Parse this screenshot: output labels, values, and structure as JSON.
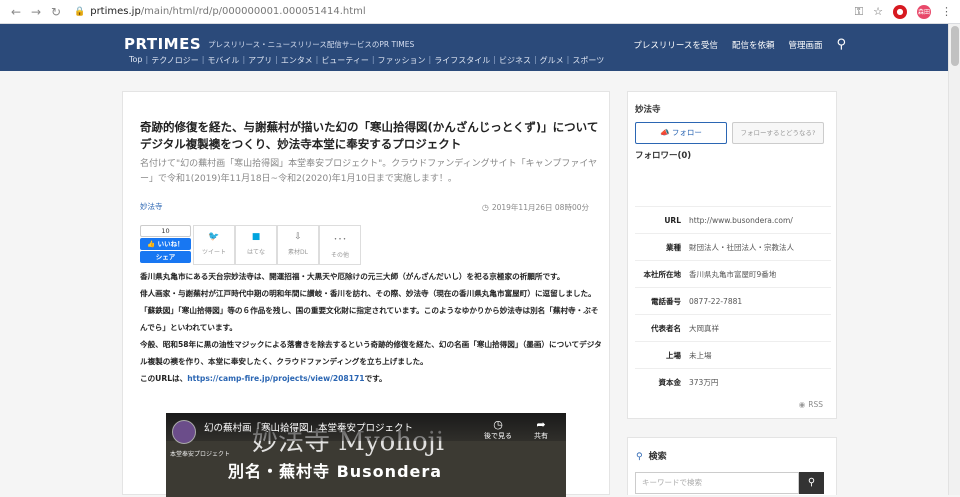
{
  "browser": {
    "url_host": "prtimes.jp",
    "url_path": "/main/html/rd/p/000000001.000051414.html",
    "avatar_text": "森田"
  },
  "header": {
    "logo": "PRTIMES",
    "tagline": "プレスリリース・ニュースリリース配信サービスのPR TIMES",
    "categories": [
      "Top",
      "テクノロジー",
      "モバイル",
      "アプリ",
      "エンタメ",
      "ビューティー",
      "ファッション",
      "ライフスタイル",
      "ビジネス",
      "グルメ",
      "スポーツ"
    ],
    "links": [
      "プレスリリースを受信",
      "配信を依頼",
      "管理画面"
    ]
  },
  "article": {
    "title": "奇跡的修復を経た、与謝蕪村が描いた幻の「寒山拾得図(かんざんじっとくず)」についてデジタル複製襖をつくり、妙法寺本堂に奉安するプロジェクト",
    "subtitle": "名付けて\"幻の蕪村画「寒山拾得図」本堂奉安プロジェクト\"。クラウドファンディングサイト「キャンプファイヤー」で令和1(2019)年11月18日~令和2(2020)年1月10日まで実施します！。",
    "company": "妙法寺",
    "date": "2019年11月26日 08時00分",
    "share": {
      "fb_count": "10",
      "fb_like": "いいね！",
      "fb_share": "シェア",
      "tweet": "ツイート",
      "hatena": "はてな",
      "pdf": "素材DL",
      "other": "その他"
    },
    "paragraphs": [
      "香川県丸亀市にある天台宗妙法寺は、開運招福・大黒天や厄除けの元三大師（がんざんだいし）を祀る京極家の祈願所です。",
      "俳人画家・与謝蕪村が江戸時代中期の明和年間に讃岐・香川を訪れ、その際、妙法寺（現在の香川県丸亀市富屋町）に逗留しました。「蘇鉄図」「寒山拾得図」等の６作品を残し、国の重要文化財に指定されています。このようなゆかりから妙法寺は別名「蕪村寺・ぶそんでら」といわれています。",
      "今般、昭和58年に黒の油性マジックによる落書きを除去するという奇跡的修復を経た、幻の名画「寒山拾得図」（墨画）についてデジタル複製の襖を作り、本堂に奉安したく、クラウドファンディングを立ち上げました。"
    ],
    "url_prefix": "このURLは、",
    "url_link": "https://camp-fire.jp/projects/view/208171",
    "url_suffix": "です。"
  },
  "video": {
    "title": "幻の蕪村画「寒山拾得図」本堂奉安プロジェクト",
    "watch_later": "後で見る",
    "share": "共有",
    "big_text": "妙法寺 Myohoji",
    "sub_text": "別名・蕪村寺 Busondera",
    "caption": "本堂奉安プロジェクト"
  },
  "sidebar": {
    "company_name": "妙法寺",
    "follow_label": "フォロー",
    "follow_help": "フォローするとどうなる?",
    "followers": "フォロワー(0)",
    "info": [
      {
        "key": "URL",
        "value": "http://www.busondera.com/"
      },
      {
        "key": "業種",
        "value": "財団法人・社団法人・宗教法人"
      },
      {
        "key": "本社所在地",
        "value": "香川県丸亀市富屋町9番地"
      },
      {
        "key": "電話番号",
        "value": "0877-22-7881"
      },
      {
        "key": "代表者名",
        "value": "大岡真祥"
      },
      {
        "key": "上場",
        "value": "未上場"
      },
      {
        "key": "資本金",
        "value": "373万円"
      }
    ],
    "rss": "RSS"
  },
  "search": {
    "heading": "検索",
    "placeholder": "キーワードで検索"
  },
  "colors": {
    "header_bg": "#2b4a7a",
    "link": "#2b66b3",
    "facebook": "#1877f2"
  }
}
